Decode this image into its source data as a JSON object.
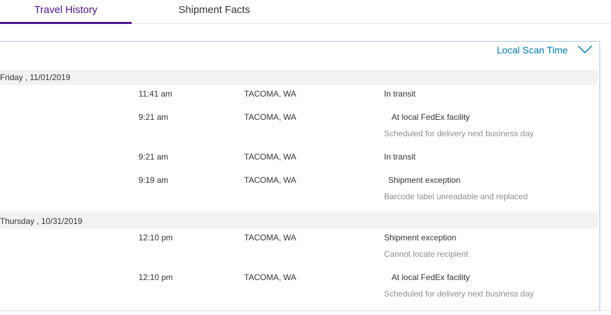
{
  "tabs": [
    {
      "label": "Travel History",
      "active": true
    },
    {
      "label": "Shipment Facts",
      "active": false
    }
  ],
  "scan_time_toggle": {
    "label": "Local Scan Time",
    "icon": "chevron-down-icon"
  },
  "colors": {
    "accent": "#4d148c",
    "link": "#007ab7",
    "panel_border": "#b9cfe4",
    "date_bar_bg": "#f2f2f2",
    "muted_text": "#8e8e8e"
  },
  "groups": [
    {
      "date": "Friday , 11/01/2019",
      "events": [
        {
          "time": "11:41 am",
          "location": "TACOMA, WA",
          "status": "In transit",
          "detail": ""
        },
        {
          "time": "9:21 am",
          "location": "TACOMA, WA",
          "status": "At local FedEx facility",
          "detail": "Scheduled for delivery next business day"
        },
        {
          "time": "9:21 am",
          "location": "TACOMA, WA",
          "status": "In transit",
          "detail": ""
        },
        {
          "time": "9:19 am",
          "location": "TACOMA, WA",
          "status": "Shipment exception",
          "detail": "Barcode label unreadable and replaced"
        }
      ]
    },
    {
      "date": "Thursday , 10/31/2019",
      "events": [
        {
          "time": "12:10 pm",
          "location": "TACOMA, WA",
          "status": "Shipment exception",
          "detail": "Cannot locate recipient"
        },
        {
          "time": "12:10 pm",
          "location": "TACOMA, WA",
          "status": "At local FedEx facility",
          "detail": "Scheduled for delivery next business day"
        }
      ]
    }
  ]
}
